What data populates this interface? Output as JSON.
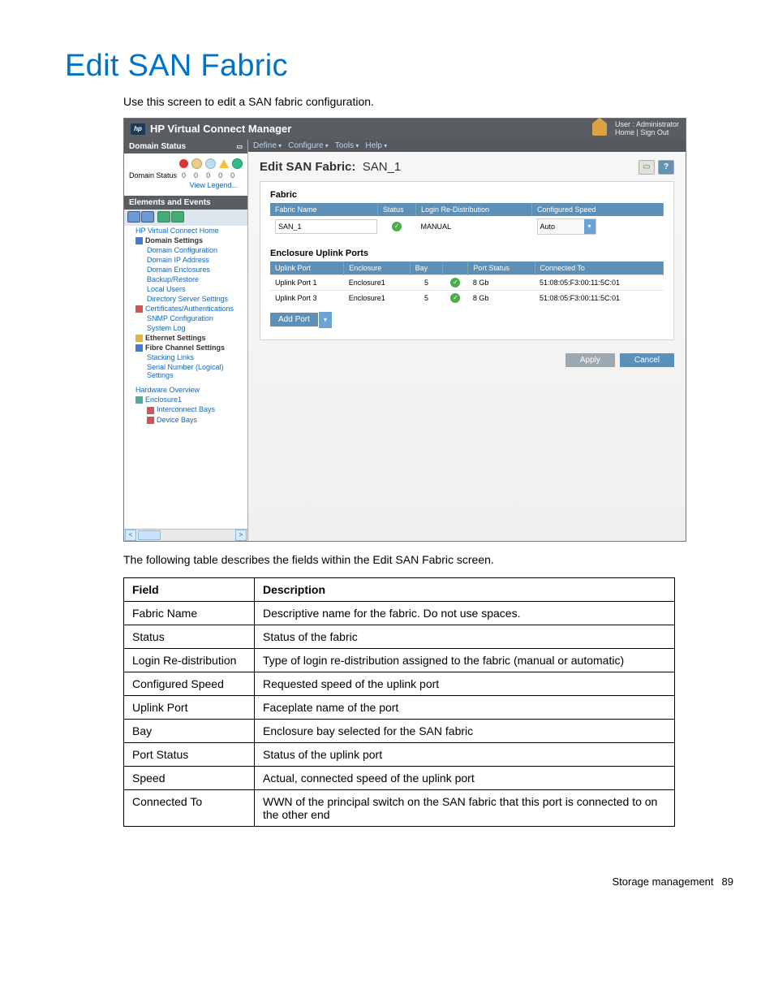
{
  "page": {
    "title": "Edit SAN Fabric",
    "intro": "Use this screen to edit a SAN fabric configuration.",
    "table_intro": "The following table describes the fields within the Edit SAN Fabric screen."
  },
  "titlebar": {
    "app": "HP Virtual Connect Manager",
    "user_label": "User : Administrator",
    "links": "Home  |  Sign Out"
  },
  "menubar": [
    "Define",
    "Configure",
    "Tools",
    "Help"
  ],
  "sidebar": {
    "status_header": "Domain Status",
    "status_label": "Domain Status",
    "counts": [
      "0",
      "0",
      "0",
      "0",
      "0"
    ],
    "view_legend": "View Legend...",
    "ee_header": "Elements and Events",
    "nav": {
      "home": "HP Virtual Connect Home",
      "domain_settings": "Domain Settings",
      "domain_items": [
        "Domain Configuration",
        "Domain IP Address",
        "Domain Enclosures",
        "Backup/Restore",
        "Local Users",
        "Directory Server Settings"
      ],
      "cert": "Certificates/Authentications",
      "cert_items": [
        "SNMP Configuration",
        "System Log"
      ],
      "ethernet": "Ethernet Settings",
      "fc": "Fibre Channel Settings",
      "fc_items": [
        "Stacking Links",
        "Serial Number (Logical) Settings"
      ],
      "hw": "Hardware Overview",
      "enc": "Enclosure1",
      "enc_items": [
        "Interconnect Bays",
        "Device Bays"
      ]
    }
  },
  "main": {
    "heading_prefix": "Edit SAN Fabric:",
    "heading_name": "SAN_1",
    "fabric_section": "Fabric",
    "fabric_headers": [
      "Fabric Name",
      "Status",
      "Login Re-Distribution",
      "Configured Speed"
    ],
    "fabric_row": {
      "name": "SAN_1",
      "login": "MANUAL",
      "speed": "Auto"
    },
    "uplink_section": "Enclosure Uplink Ports",
    "uplink_headers": [
      "Uplink Port",
      "Enclosure",
      "Bay",
      "",
      "Port Status",
      "Connected To"
    ],
    "uplink_rows": [
      {
        "port": "Uplink Port 1",
        "enc": "Enclosure1",
        "bay": "5",
        "speed": "8 Gb",
        "conn": "51:08:05:F3:00:11:5C:01"
      },
      {
        "port": "Uplink Port 3",
        "enc": "Enclosure1",
        "bay": "5",
        "speed": "8 Gb",
        "conn": "51:08:05:F3:00:11:5C:01"
      }
    ],
    "add_port": "Add Port",
    "apply": "Apply",
    "cancel": "Cancel"
  },
  "fields_table": {
    "head": [
      "Field",
      "Description"
    ],
    "rows": [
      [
        "Fabric Name",
        "Descriptive name for the fabric. Do not use spaces."
      ],
      [
        "Status",
        "Status of the fabric"
      ],
      [
        "Login Re-distribution",
        "Type of login re-distribution assigned to the fabric (manual or automatic)"
      ],
      [
        "Configured Speed",
        "Requested speed of the uplink port"
      ],
      [
        "Uplink Port",
        "Faceplate name of the port"
      ],
      [
        "Bay",
        "Enclosure bay selected for the SAN fabric"
      ],
      [
        "Port Status",
        "Status of the uplink port"
      ],
      [
        "Speed",
        "Actual, connected speed of the uplink port"
      ],
      [
        "Connected To",
        "WWN of the principal switch on the SAN fabric that this port is connected to on the other end"
      ]
    ]
  },
  "footer": {
    "section": "Storage management",
    "page": "89"
  }
}
